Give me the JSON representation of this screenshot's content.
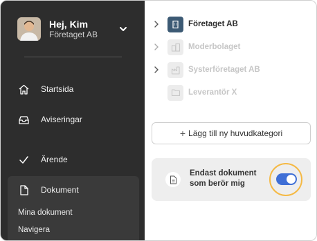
{
  "sidebar": {
    "user": {
      "greeting": "Hej, Kim",
      "company": "Företaget AB"
    },
    "nav": [
      {
        "label": "Startsida",
        "icon": "home-icon"
      },
      {
        "label": "Aviseringar",
        "icon": "inbox-icon"
      },
      {
        "label": "Ärende",
        "icon": "check-icon"
      },
      {
        "label": "Dokument",
        "icon": "document-icon"
      }
    ],
    "sub": [
      "Mina dokument",
      "Navigera"
    ]
  },
  "tree": [
    {
      "label": "Företaget AB",
      "icon": "building-icon",
      "active": true,
      "expandable": true
    },
    {
      "label": "Moderbolaget",
      "icon": "buildings-icon",
      "active": false,
      "expandable": true
    },
    {
      "label": "Systerföretaget AB",
      "icon": "factory-icon",
      "active": false,
      "expandable": true
    },
    {
      "label": "Leverantör X",
      "icon": "folder-icon",
      "active": false,
      "expandable": false
    }
  ],
  "add_button": {
    "label": "Lägg till ny huvudkategori"
  },
  "filter": {
    "line1": "Endast dokument",
    "line2": "som berör mig",
    "enabled": true
  },
  "colors": {
    "sidebar": "#2d2d2d",
    "active_box": "#3c5a74",
    "toggle": "#3f6fd6",
    "highlight_ring": "#f5b944"
  }
}
